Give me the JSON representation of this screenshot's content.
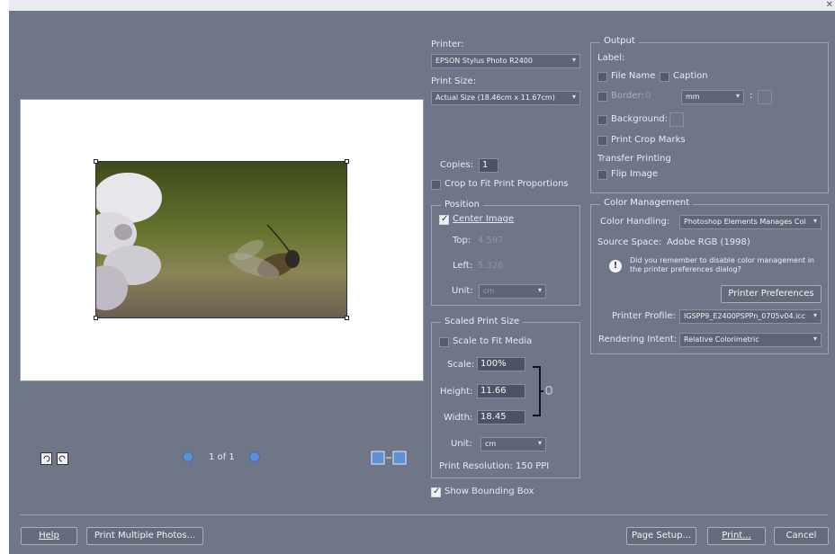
{
  "page_dot": "1 of 1",
  "printer": {
    "label": "Printer:",
    "value": "EPSON Stylus Photo R2400"
  },
  "print_size": {
    "label": "Print Size:",
    "value": "Actual Size (18.46cm x 11.67cm)"
  },
  "copies": {
    "label": "Copies:",
    "value": "1"
  },
  "crop_to_fit": "Crop to Fit Print Proportions",
  "position": {
    "title": "Position",
    "center_image": "Center Image",
    "top_label": "Top:",
    "top_value": "4.597",
    "left_label": "Left:",
    "left_value": "5.326",
    "unit_label": "Unit:",
    "unit_value": "cm"
  },
  "scaled": {
    "title": "Scaled Print Size",
    "scale_to_fit": "Scale to Fit Media",
    "scale_label": "Scale:",
    "scale_value": "100%",
    "height_label": "Height:",
    "height_value": "11.66",
    "width_label": "Width:",
    "width_value": "18.45",
    "unit_label": "Unit:",
    "unit_value": "cm",
    "resolution": "Print Resolution: 150 PPI"
  },
  "show_bounding_box": "Show Bounding Box",
  "output": {
    "title": "Output",
    "label": "Label:",
    "file_name": "File Name",
    "caption": "Caption",
    "border": "Border:",
    "border_value": "0",
    "border_unit": "mm",
    "background": "Background:",
    "crop_marks": "Print Crop Marks",
    "transfer": "Transfer Printing",
    "flip": "Flip Image"
  },
  "color": {
    "title": "Color Management",
    "handling_label": "Color Handling:",
    "handling_value": "Photoshop Elements Manages Col",
    "source_label": "Source Space:",
    "source_value": "Adobe RGB (1998)",
    "notice": "Did you remember to disable color management in the printer preferences dialog?",
    "prefs_button": "Printer Preferences",
    "profile_label": "Printer Profile:",
    "profile_value": "IGSPP9_E2400PSPPn_0705v04.icc",
    "intent_label": "Rendering Intent:",
    "intent_value": "Relative Colorimetric"
  },
  "buttons": {
    "help": "Help",
    "multiple": "Print Multiple Photos...",
    "page_setup": "Page Setup...",
    "print": "Print...",
    "cancel": "Cancel"
  },
  "colors": {
    "dialog_bg": "#6e7687",
    "accent_blue": "#5d8fd3"
  }
}
